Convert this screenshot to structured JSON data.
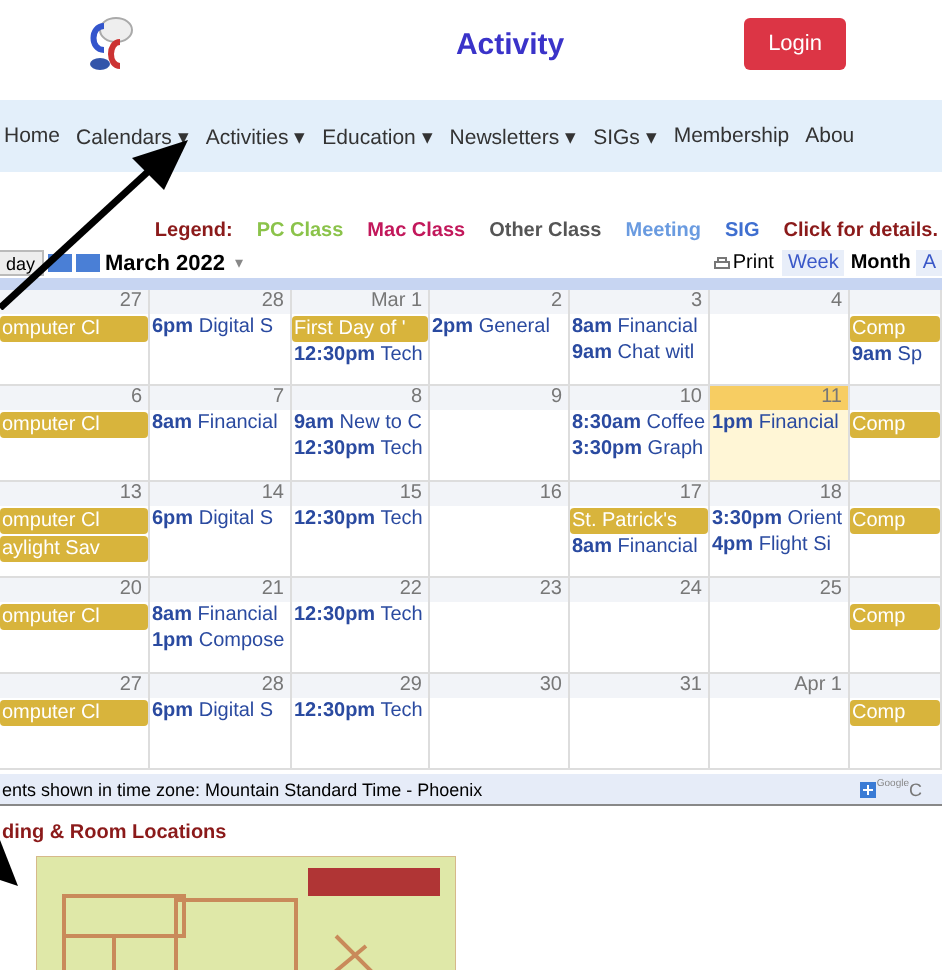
{
  "header": {
    "title": "Activity",
    "login": "Login"
  },
  "nav": [
    {
      "label": "Home"
    },
    {
      "label": "Calendars",
      "caret": "▾"
    },
    {
      "label": "Activities",
      "caret": "▾"
    },
    {
      "label": "Education",
      "caret": "▾"
    },
    {
      "label": "Newsletters",
      "caret": "▾"
    },
    {
      "label": "SIGs",
      "caret": "▾"
    },
    {
      "label": "Membership"
    },
    {
      "label": "Abou"
    }
  ],
  "legend": {
    "label": "Legend:",
    "items": [
      {
        "label": "PC Class",
        "color": "#8bc34a"
      },
      {
        "label": "Mac Class",
        "color": "#c2185b"
      },
      {
        "label": "Other Class",
        "color": "#555555"
      },
      {
        "label": "Meeting",
        "color": "#6a9be0"
      },
      {
        "label": "SIG",
        "color": "#3f6fd0"
      },
      {
        "label": "Click for details.",
        "color": "#8b1a1a"
      }
    ]
  },
  "toolbar": {
    "today": "day",
    "month": "March 2022",
    "caret": "▾",
    "print": "Print",
    "views": [
      {
        "label": "Week",
        "selected": false
      },
      {
        "label": "Month",
        "selected": true
      },
      {
        "label": "A",
        "selected": false
      }
    ]
  },
  "weeks": [
    [
      {
        "date": "27",
        "today": false,
        "events": [
          {
            "kind": "chip",
            "title": "omputer Cl"
          }
        ]
      },
      {
        "date": "28",
        "today": false,
        "events": [
          {
            "kind": "timed",
            "time": "6pm",
            "title": "Digital S"
          }
        ]
      },
      {
        "date": "Mar 1",
        "today": false,
        "events": [
          {
            "kind": "chip",
            "title": "First Day of '"
          },
          {
            "kind": "timed",
            "time": "12:30pm",
            "title": "Tech"
          }
        ]
      },
      {
        "date": "2",
        "today": false,
        "events": [
          {
            "kind": "timed",
            "time": "2pm",
            "title": "General"
          }
        ]
      },
      {
        "date": "3",
        "today": false,
        "events": [
          {
            "kind": "timed",
            "time": "8am",
            "title": "Financial"
          },
          {
            "kind": "timed",
            "time": "9am",
            "title": "Chat witl"
          }
        ]
      },
      {
        "date": "4",
        "today": false
      },
      {
        "today": false,
        "events": [
          {
            "kind": "chip",
            "title": "Comp"
          },
          {
            "kind": "timed",
            "time": "9am",
            "title": "Sp"
          }
        ]
      }
    ],
    [
      {
        "date": "6",
        "today": false,
        "events": [
          {
            "kind": "chip",
            "title": "omputer Cl"
          }
        ]
      },
      {
        "date": "7",
        "today": false,
        "events": [
          {
            "kind": "timed",
            "time": "8am",
            "title": "Financial"
          }
        ]
      },
      {
        "date": "8",
        "today": false,
        "events": [
          {
            "kind": "timed",
            "time": "9am",
            "title": "New to C"
          },
          {
            "kind": "timed",
            "time": "12:30pm",
            "title": "Tech"
          }
        ]
      },
      {
        "date": "9",
        "today": false
      },
      {
        "date": "10",
        "today": false,
        "events": [
          {
            "kind": "timed",
            "time": "8:30am",
            "title": "Coffee"
          },
          {
            "kind": "timed",
            "time": "3:30pm",
            "title": "Graph"
          }
        ]
      },
      {
        "date": "11",
        "today": true,
        "events": [
          {
            "kind": "timed",
            "time": "1pm",
            "title": "Financial"
          }
        ]
      },
      {
        "today": false,
        "events": [
          {
            "kind": "chip",
            "title": "Comp"
          }
        ]
      }
    ],
    [
      {
        "date": "13",
        "today": false,
        "events": [
          {
            "kind": "chip",
            "title": "omputer Cl"
          },
          {
            "kind": "chip",
            "title": "aylight Sav"
          }
        ]
      },
      {
        "date": "14",
        "today": false,
        "events": [
          {
            "kind": "timed",
            "time": "6pm",
            "title": "Digital S"
          }
        ]
      },
      {
        "date": "15",
        "today": false,
        "events": [
          {
            "kind": "timed",
            "time": "12:30pm",
            "title": "Tech"
          }
        ]
      },
      {
        "date": "16",
        "today": false
      },
      {
        "date": "17",
        "today": false,
        "events": [
          {
            "kind": "chip",
            "title": "St. Patrick's"
          },
          {
            "kind": "timed",
            "time": "8am",
            "title": "Financial"
          }
        ]
      },
      {
        "date": "18",
        "today": false,
        "events": [
          {
            "kind": "timed",
            "time": "3:30pm",
            "title": "Orient"
          },
          {
            "kind": "timed",
            "time": "4pm",
            "title": "Flight Si"
          }
        ]
      },
      {
        "today": false,
        "events": [
          {
            "kind": "chip",
            "title": "Comp"
          }
        ]
      }
    ],
    [
      {
        "date": "20",
        "today": false,
        "events": [
          {
            "kind": "chip",
            "title": "omputer Cl"
          }
        ]
      },
      {
        "date": "21",
        "today": false,
        "events": [
          {
            "kind": "timed",
            "time": "8am",
            "title": "Financial"
          },
          {
            "kind": "timed",
            "time": "1pm",
            "title": "Compose"
          }
        ]
      },
      {
        "date": "22",
        "today": false,
        "events": [
          {
            "kind": "timed",
            "time": "12:30pm",
            "title": "Tech"
          }
        ]
      },
      {
        "date": "23",
        "today": false
      },
      {
        "date": "24",
        "today": false
      },
      {
        "date": "25",
        "today": false
      },
      {
        "today": false,
        "events": [
          {
            "kind": "chip",
            "title": "Comp"
          }
        ]
      }
    ],
    [
      {
        "date": "27",
        "today": false,
        "events": [
          {
            "kind": "chip",
            "title": "omputer Cl"
          }
        ]
      },
      {
        "date": "28",
        "today": false,
        "events": [
          {
            "kind": "timed",
            "time": "6pm",
            "title": "Digital S"
          }
        ]
      },
      {
        "date": "29",
        "today": false,
        "events": [
          {
            "kind": "timed",
            "time": "12:30pm",
            "title": "Tech"
          }
        ]
      },
      {
        "date": "30",
        "today": false
      },
      {
        "date": "31",
        "today": false
      },
      {
        "date": "Apr 1",
        "today": false
      },
      {
        "today": false,
        "events": [
          {
            "kind": "chip",
            "title": "Comp"
          }
        ]
      }
    ]
  ],
  "footer": {
    "timezone": "ents shown in time zone: Mountain Standard Time - Phoenix",
    "brand": "Google",
    "brand_tail": "C"
  },
  "section_title": "ding & Room Locations"
}
